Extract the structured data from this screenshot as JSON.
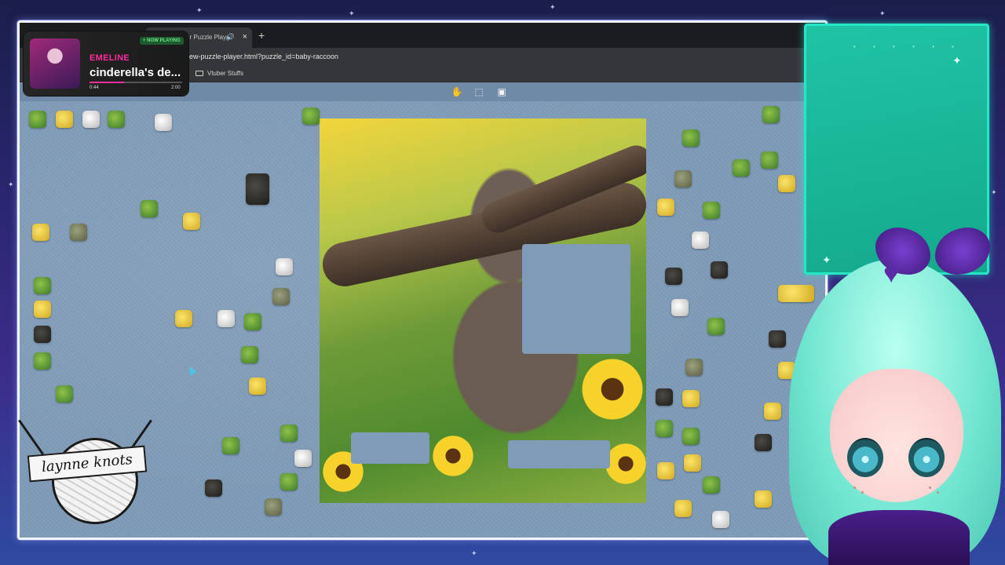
{
  "browser": {
    "tab_title": "er Puzzle Playe",
    "url": "ew-puzzle-player.html?puzzle_id=baby-raccoon",
    "bookmark_folder": "Vtuber Stuffs"
  },
  "now_playing": {
    "badge": "+ NOW PLAYING",
    "artist": "EMELINE",
    "track": "cinderella's de...",
    "elapsed": "0:44",
    "duration": "2:00",
    "progress": 0.37
  },
  "toolbar": {
    "icons": [
      "hand-icon",
      "select-region-icon",
      "image-preview-icon"
    ]
  },
  "puzzle": {
    "puzzle_id": "baby-raccoon"
  },
  "logo": {
    "text": "laynne knots"
  },
  "colors": {
    "table": "#7f9bb7",
    "accent_pink": "#ff2da0",
    "panel_teal": "#20c3a5"
  }
}
